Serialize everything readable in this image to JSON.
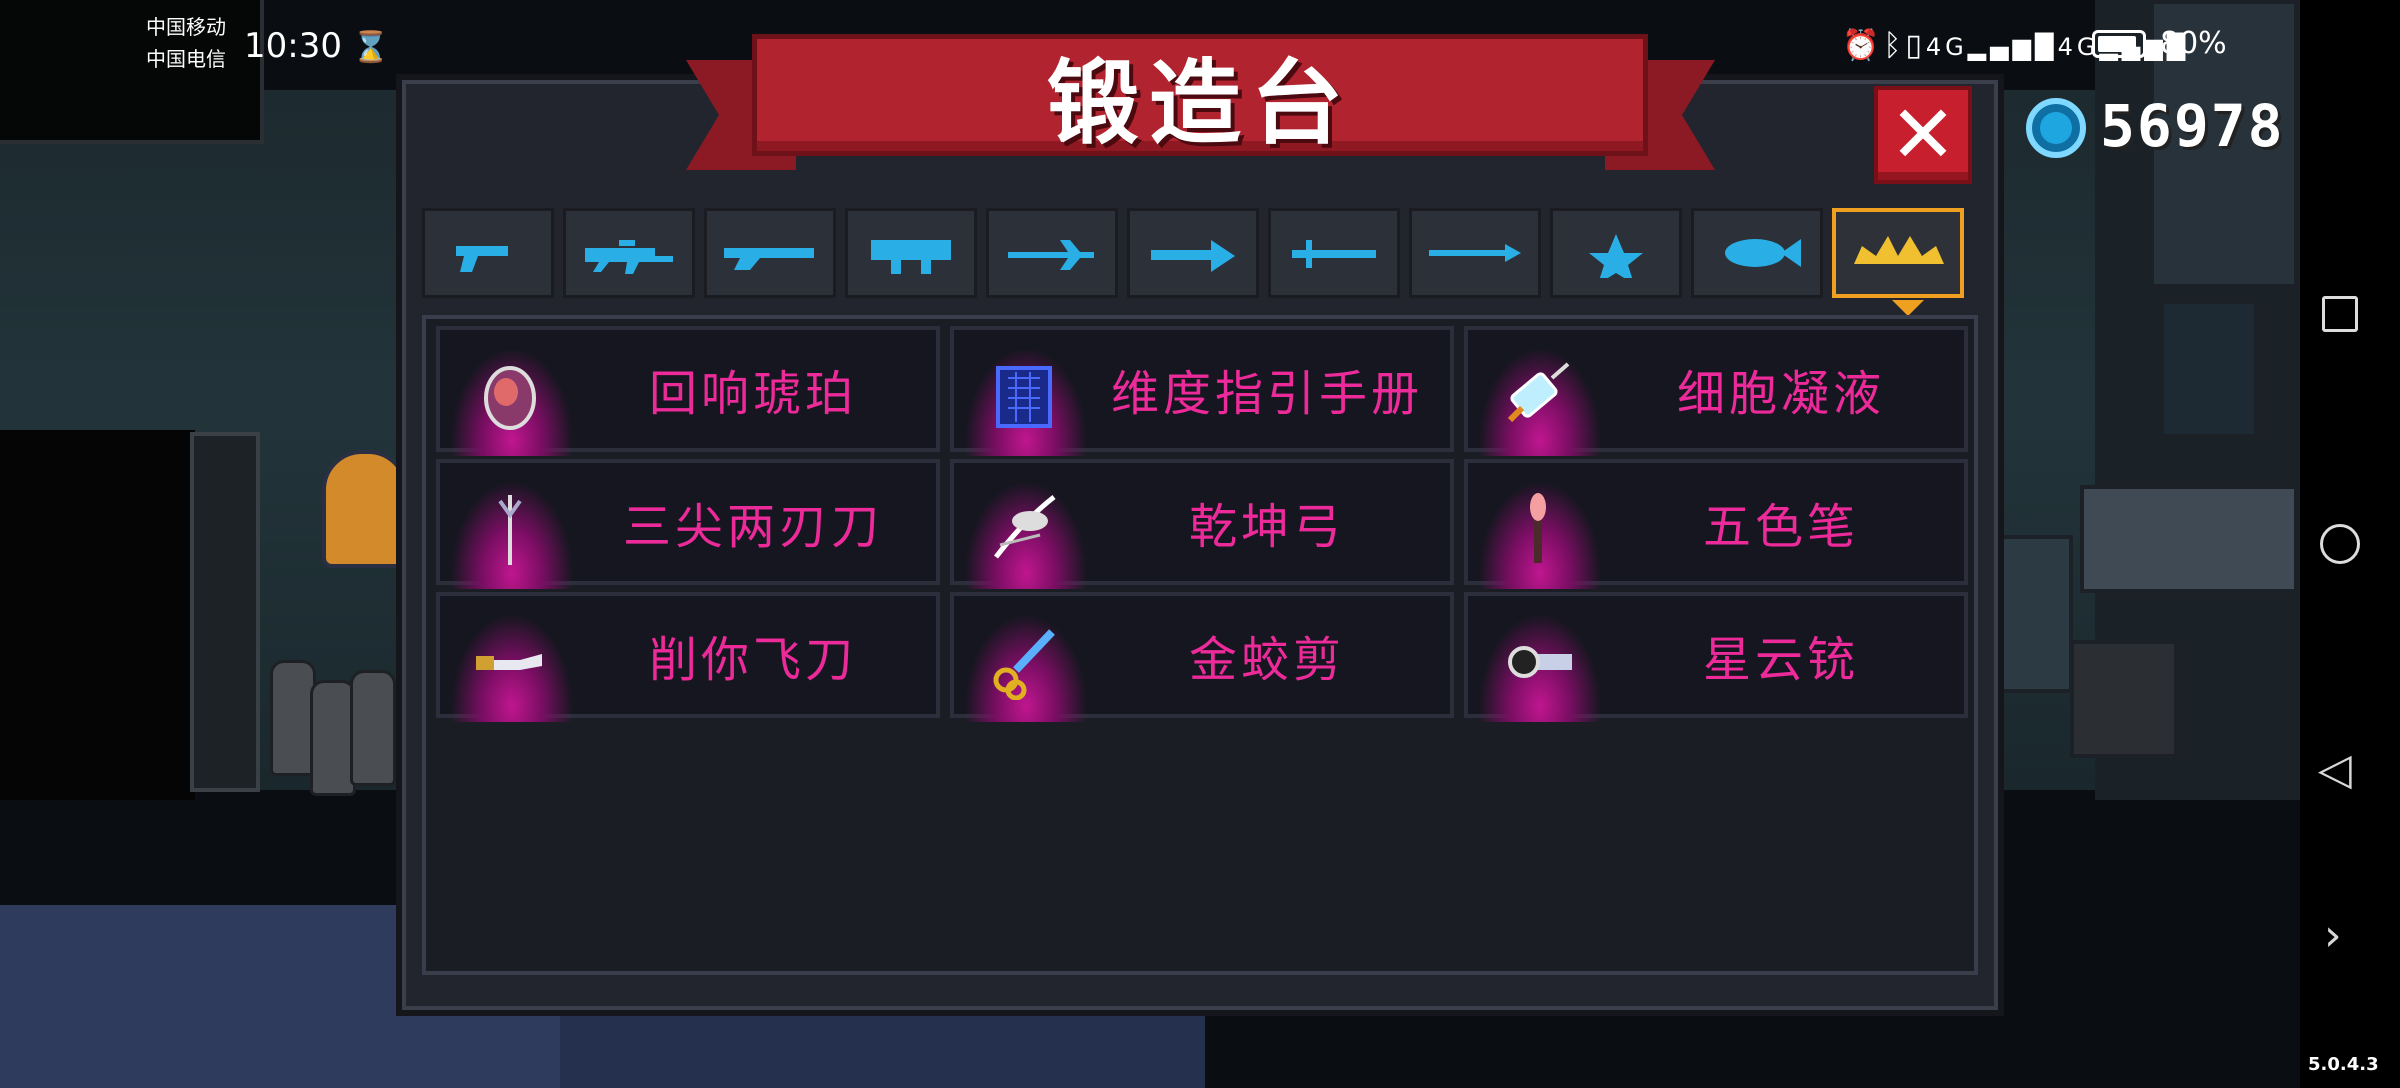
{
  "status_bar": {
    "carrier_1": "中国移动",
    "carrier_2": "中国电信",
    "time": "10:30",
    "battery": "80%",
    "icons": [
      "hourglass-icon",
      "alarm-icon",
      "bluetooth-icon",
      "vibrate-icon",
      "signal-4g-icon",
      "signal-4g-icon",
      "battery-icon"
    ]
  },
  "title": "锻造台",
  "close_label": "✕",
  "gems": {
    "icon": "gem-icon",
    "count": "56978"
  },
  "tabs": [
    {
      "name": "pistol",
      "icon": "pistol-icon",
      "active": false
    },
    {
      "name": "rifle",
      "icon": "rifle-icon",
      "active": false
    },
    {
      "name": "shotgun",
      "icon": "shotgun-icon",
      "active": false
    },
    {
      "name": "launcher",
      "icon": "launcher-icon",
      "active": false
    },
    {
      "name": "laser",
      "icon": "laser-icon",
      "active": false
    },
    {
      "name": "bow",
      "icon": "bow-icon",
      "active": false
    },
    {
      "name": "melee",
      "icon": "sword-icon",
      "active": false
    },
    {
      "name": "spear",
      "icon": "spear-icon",
      "active": false
    },
    {
      "name": "throwing",
      "icon": "shuriken-icon",
      "active": false
    },
    {
      "name": "other",
      "icon": "fish-icon",
      "active": false
    },
    {
      "name": "special",
      "icon": "crown-icon",
      "active": true
    }
  ],
  "items": [
    {
      "label": "回响琥珀",
      "icon": "amber-gem-icon"
    },
    {
      "label": "维度指引手册",
      "icon": "manual-icon"
    },
    {
      "label": "细胞凝液",
      "icon": "syringe-icon"
    },
    {
      "label": "三尖两刃刀",
      "icon": "trident-icon"
    },
    {
      "label": "乾坤弓",
      "icon": "bow-icon"
    },
    {
      "label": "五色笔",
      "icon": "brush-icon"
    },
    {
      "label": "削你飞刀",
      "icon": "knife-icon"
    },
    {
      "label": "金蛟剪",
      "icon": "scissors-icon"
    },
    {
      "label": "星云铳",
      "icon": "blaster-icon"
    }
  ],
  "colors": {
    "accent": "#ec2a9a",
    "tab_active": "#f0a020",
    "tab_icon": "#29aee6",
    "banner": "#b1232f"
  },
  "version": "5.0.4.3",
  "nav": {
    "recent": "recent-apps-icon",
    "home": "home-icon",
    "back": "back-icon",
    "expand": "chevron-right-icon"
  }
}
